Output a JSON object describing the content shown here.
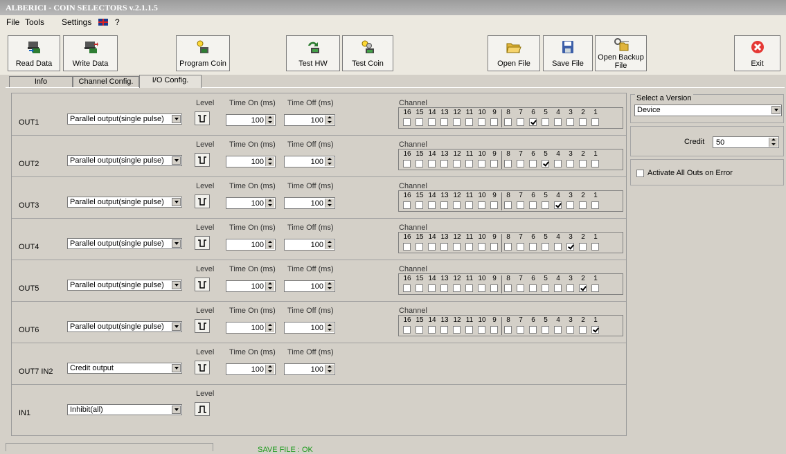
{
  "window": {
    "title": "ALBERICI - COIN SELECTORS v.2.1.1.5"
  },
  "menu": [
    "File",
    "Tools",
    "Settings",
    "?"
  ],
  "toolbar": [
    {
      "label": "Read Data",
      "icon": "read-data-icon"
    },
    {
      "label": "Write Data",
      "icon": "write-data-icon"
    },
    {
      "label": "Program Coin",
      "icon": "program-coin-icon"
    },
    {
      "label": "Test HW",
      "icon": "test-hw-icon"
    },
    {
      "label": "Test Coin",
      "icon": "test-coin-icon"
    },
    {
      "label": "Open File",
      "icon": "open-folder-icon"
    },
    {
      "label": "Save File",
      "icon": "floppy-disk-icon"
    },
    {
      "label": "Open Backup File",
      "icon": "open-backup-icon"
    },
    {
      "label": "Exit",
      "icon": "exit-icon"
    }
  ],
  "tabs": [
    "Info",
    "Channel Config.",
    "I/O Config."
  ],
  "active_tab": "I/O Config.",
  "headers": {
    "level": "Level",
    "time_on": "Time On (ms)",
    "time_off": "Time Off (ms)",
    "channel": "Channel"
  },
  "channel_numbers": [
    "16",
    "15",
    "14",
    "13",
    "12",
    "11",
    "10",
    "9",
    "8",
    "7",
    "6",
    "5",
    "4",
    "3",
    "2",
    "1"
  ],
  "outputs": [
    {
      "name": "OUT1",
      "mode": "Parallel output(single pulse)",
      "time_on": "100",
      "time_off": "100",
      "checked": [
        6
      ]
    },
    {
      "name": "OUT2",
      "mode": "Parallel output(single pulse)",
      "time_on": "100",
      "time_off": "100",
      "checked": [
        5
      ]
    },
    {
      "name": "OUT3",
      "mode": "Parallel output(single pulse)",
      "time_on": "100",
      "time_off": "100",
      "checked": [
        4
      ]
    },
    {
      "name": "OUT4",
      "mode": "Parallel output(single pulse)",
      "time_on": "100",
      "time_off": "100",
      "checked": [
        3
      ]
    },
    {
      "name": "OUT5",
      "mode": "Parallel output(single pulse)",
      "time_on": "100",
      "time_off": "100",
      "checked": [
        2
      ]
    },
    {
      "name": "OUT6",
      "mode": "Parallel output(single pulse)",
      "time_on": "100",
      "time_off": "100",
      "checked": [
        1
      ]
    },
    {
      "name": "OUT7 IN2",
      "mode": "Credit output",
      "time_on": "100",
      "time_off": "100"
    },
    {
      "name": "IN1",
      "mode": "Inhibit(all)"
    }
  ],
  "right_panel": {
    "version_label": "Select a Version",
    "version_value": "Device",
    "credit_label": "Credit",
    "credit_value": "50",
    "activate_label": "Activate All Outs on Error",
    "activate_checked": false
  },
  "status": {
    "text": "SAVE FILE : OK",
    "color": "#1a9a1a"
  }
}
